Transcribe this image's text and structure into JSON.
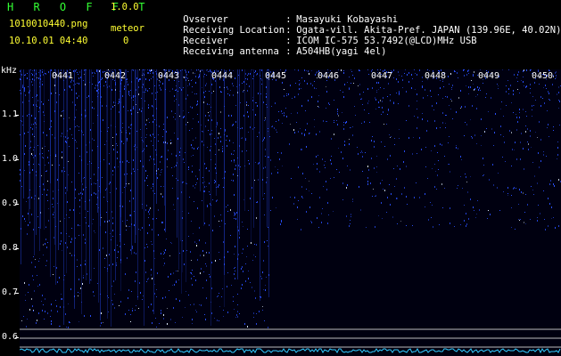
{
  "header": {
    "app_title": "H R O F F T",
    "version": "1.0.0",
    "file_name": "1010010440.png",
    "meteor_label": "meteor",
    "meteor_count": "0",
    "datetime": "10.10.01 04:40"
  },
  "info": [
    {
      "key": "Ovserver",
      "value": "Masayuki Kobayashi"
    },
    {
      "key": "Receiving Location",
      "value": "Ogata-vill. Akita-Pref. JAPAN (139.96E, 40.02N)"
    },
    {
      "key": "Receiver",
      "value": "ICOM IC-575 53.7492(@LCD)MHz USB"
    },
    {
      "key": "Receiving antenna",
      "value": "A504HB(yagi 4el)"
    }
  ],
  "spectrogram": {
    "y_axis_label": "kHz",
    "y_ticks": [
      "1.1",
      "1.0",
      "0.9",
      "0.8",
      "0.7",
      "0.6"
    ],
    "minute_labels": [
      "0441",
      "0442",
      "0443",
      "0444",
      "0445",
      "0446",
      "0447",
      "0448",
      "0449",
      "0450"
    ],
    "colors": {
      "signal": "#2a4fff",
      "bright": "#e0ecff",
      "trace": "#33ccff"
    }
  }
}
